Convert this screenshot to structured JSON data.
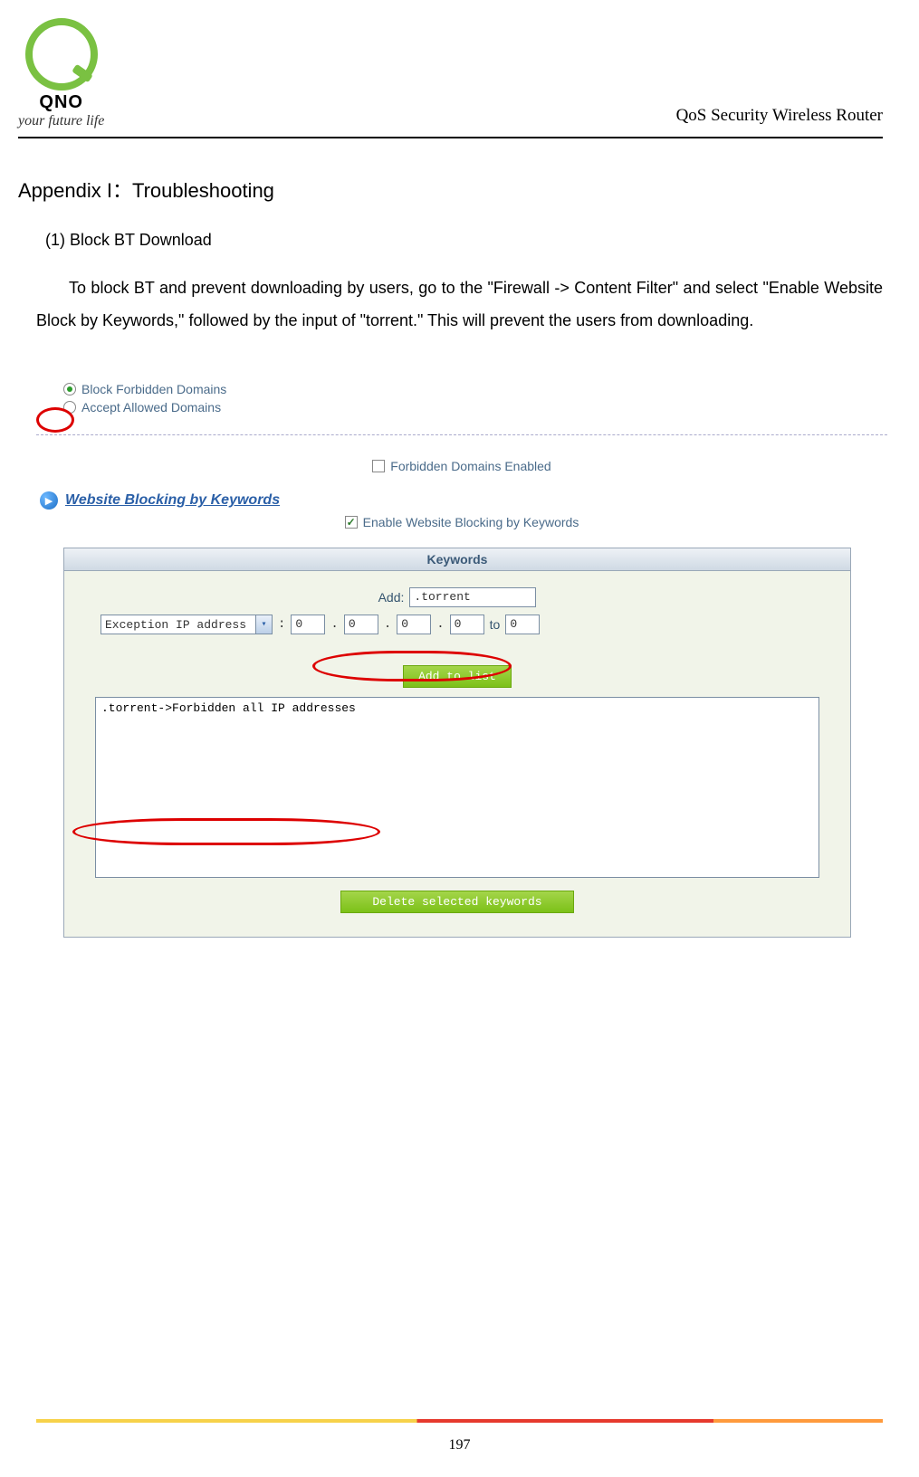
{
  "header": {
    "brand": "QNO",
    "tagline": "your future life",
    "doc_title": "QoS Security Wireless Router"
  },
  "appendix": {
    "title": "Appendix I：Troubleshooting",
    "subtitle": "(1) Block BT Download",
    "paragraph": "To block BT and prevent downloading by users, go to the \"Firewall -> Content Filter\" and select \"Enable Website Block by Keywords,\" followed by the input of \"torrent.\" This will prevent the users from downloading."
  },
  "ui": {
    "radios": {
      "block_label": "Block Forbidden Domains",
      "accept_label": "Accept Allowed Domains",
      "block_selected": true
    },
    "forbidden_check": {
      "label": "Forbidden Domains Enabled",
      "checked": false
    },
    "section_title": "Website Blocking by Keywords",
    "enable_check": {
      "label": "Enable Website Blocking by Keywords",
      "checked": true
    },
    "keywords": {
      "table_header": "Keywords",
      "add_label": "Add:",
      "add_value": ".torrent",
      "exception_select": "Exception IP address",
      "ip": {
        "o1": "0",
        "o2": "0",
        "o3": "0",
        "o4": "0",
        "to": "to",
        "o5": "0"
      },
      "add_button": "Add to list",
      "list_item": ".torrent->Forbidden all IP addresses",
      "delete_button": "Delete selected keywords"
    }
  },
  "footer": {
    "page": "197"
  }
}
